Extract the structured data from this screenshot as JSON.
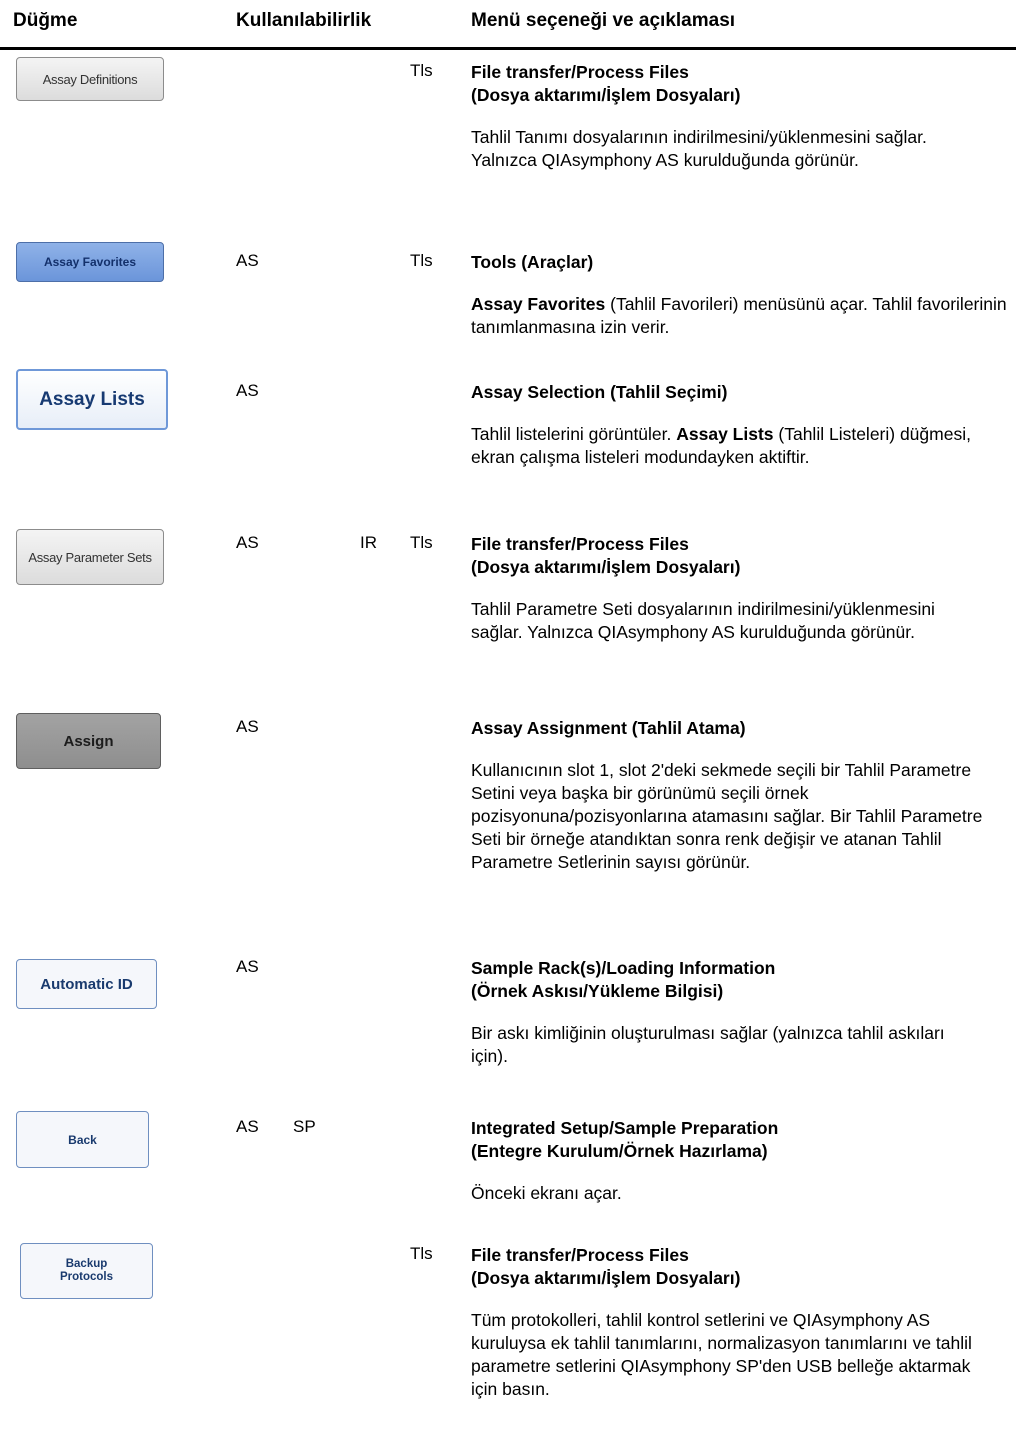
{
  "header": {
    "col_button": "Düğme",
    "col_availability": "Kullanılabilirlik",
    "col_menu": "Menü seçeneği ve açıklaması"
  },
  "rows": [
    {
      "button_label": "Assay Definitions",
      "avail": [
        "",
        "",
        "",
        "Tls"
      ],
      "menu_lines": [
        "File transfer/Process Files",
        "(Dosya aktarımı/İşlem Dosyaları)"
      ],
      "description": "Tahlil Tanımı dosyalarının indirilmesini/yüklenmesini sağlar. Yalnızca QIAsymphony AS kurulduğunda görünür."
    },
    {
      "button_label": "Assay Favorites",
      "avail": [
        "AS",
        "",
        "",
        "Tls"
      ],
      "menu_lines": [
        "Tools (Araçlar)"
      ],
      "desc_bold": "Assay Favorites",
      "description": " (Tahlil Favorileri) menüsünü açar. Tahlil favorilerinin tanımlanmasına izin verir."
    },
    {
      "button_label": "Assay Lists",
      "avail": [
        "AS",
        "",
        "",
        ""
      ],
      "menu_lines": [
        "Assay Selection (Tahlil Seçimi)"
      ],
      "desc_pre": "Tahlil listelerini görüntüler. ",
      "desc_bold": "Assay Lists",
      "description": " (Tahlil Listeleri) düğmesi, ekran çalışma listeleri modundayken aktiftir."
    },
    {
      "button_label": "Assay Parameter Sets",
      "avail": [
        "AS",
        "",
        "IR",
        "Tls"
      ],
      "menu_lines": [
        "File transfer/Process Files",
        "(Dosya aktarımı/İşlem Dosyaları)"
      ],
      "description": "Tahlil Parametre Seti dosyalarının indirilmesini/yüklenmesini sağlar. Yalnızca QIAsymphony AS kurulduğunda görünür."
    },
    {
      "button_label": "Assign",
      "avail": [
        "AS",
        "",
        "",
        ""
      ],
      "menu_lines": [
        "Assay Assignment (Tahlil Atama)"
      ],
      "description": "Kullanıcının slot 1, slot 2'deki sekmede seçili bir Tahlil Parametre Setini veya başka bir görünümü seçili örnek pozisyonuna/pozisyonlarına atamasını sağlar. Bir Tahlil Parametre Seti bir örneğe atandıktan sonra renk değişir ve atanan Tahlil Parametre Setlerinin sayısı görünür."
    },
    {
      "button_label": "Automatic ID",
      "avail": [
        "AS",
        "",
        "",
        ""
      ],
      "menu_lines": [
        "Sample Rack(s)/Loading Information",
        "(Örnek Askısı/Yükleme Bilgisi)"
      ],
      "description": "Bir askı kimliğinin oluşturulması sağlar (yalnızca tahlil askıları için)."
    },
    {
      "button_label": "Back",
      "avail": [
        "AS",
        "SP",
        "",
        ""
      ],
      "menu_lines": [
        "Integrated Setup/Sample Preparation",
        "(Entegre Kurulum/Örnek Hazırlama)"
      ],
      "description": "Önceki ekranı açar."
    },
    {
      "button_label_lines": [
        "Backup",
        "Protocols"
      ],
      "avail": [
        "",
        "",
        "",
        "Tls"
      ],
      "menu_lines": [
        "File transfer/Process Files",
        "(Dosya aktarımı/İşlem Dosyaları)"
      ],
      "description": "Tüm protokolleri, tahlil kontrol setlerini ve QIAsymphony AS kuruluysa ek tahlil tanımlarını, normalizasyon tanımlarını ve tahlil parametre setlerini QIAsymphony SP'den USB belleğe aktarmak için basın."
    }
  ]
}
